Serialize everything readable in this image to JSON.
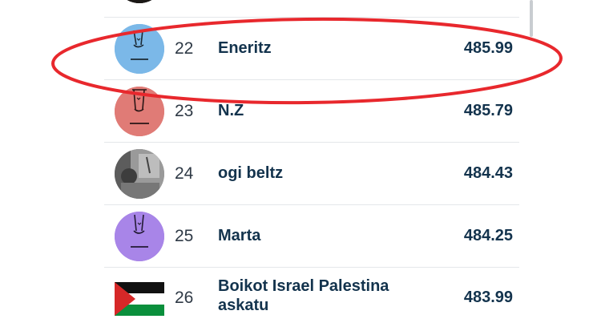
{
  "leaderboard": {
    "rows": [
      {
        "rank": "22",
        "name": "Eneritz",
        "score": "485.99",
        "avatar_icon": "blue-face-avatar-icon",
        "avatar_color": "#7bb8e8"
      },
      {
        "rank": "23",
        "name": "N.Z",
        "score": "485.79",
        "avatar_icon": "red-face-avatar-icon",
        "avatar_color": "#e07b76"
      },
      {
        "rank": "24",
        "name": "ogi beltz",
        "score": "484.43",
        "avatar_icon": "photo-avatar-icon",
        "avatar_color": "#8a8a8a"
      },
      {
        "rank": "25",
        "name": "Marta",
        "score": "484.25",
        "avatar_icon": "purple-face-avatar-icon",
        "avatar_color": "#a885e8"
      },
      {
        "rank": "26",
        "name": "Boikot Israel Palestina askatu",
        "score": "483.99",
        "avatar_icon": "palestine-flag-icon",
        "avatar_color": "#009736"
      }
    ]
  },
  "highlight": {
    "color": "#e8282d",
    "target_rank": "22"
  },
  "colors": {
    "text_dark": "#13334d",
    "rank_text": "#2f3a46",
    "divider": "#e4e7ea"
  }
}
